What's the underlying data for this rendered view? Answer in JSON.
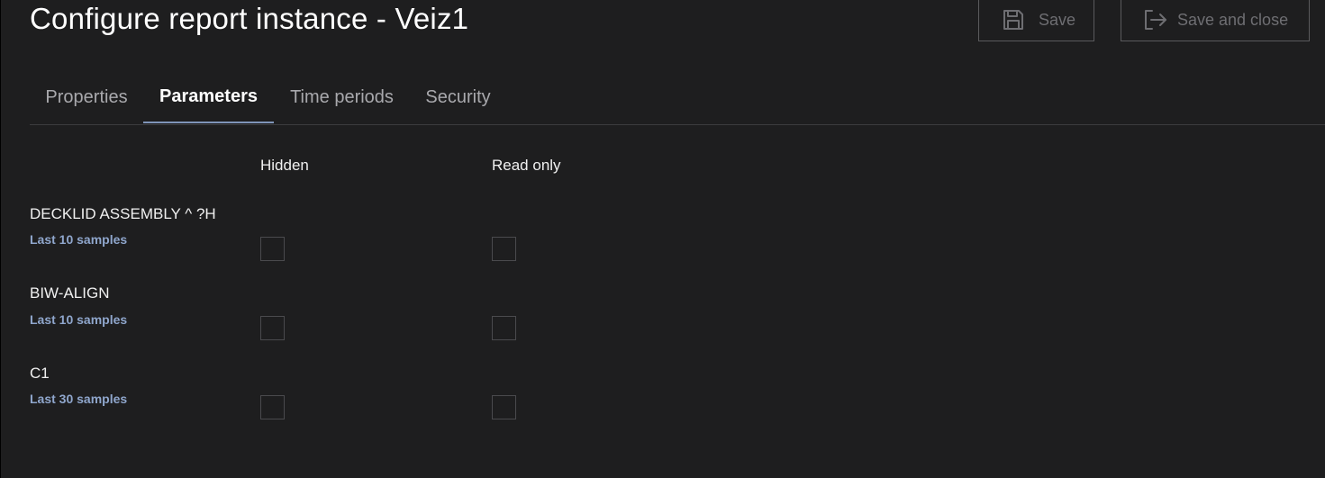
{
  "header": {
    "title": "Configure report instance - Veiz1",
    "save_label": "Save",
    "save_close_label": "Save and close",
    "save_icon": "floppy-disk-icon",
    "save_close_icon": "exit-icon"
  },
  "tabs": [
    {
      "label": "Properties",
      "active": false
    },
    {
      "label": "Parameters",
      "active": true
    },
    {
      "label": "Time periods",
      "active": false
    },
    {
      "label": "Security",
      "active": false
    }
  ],
  "columns": {
    "hidden": "Hidden",
    "read_only": "Read only"
  },
  "parameters": [
    {
      "name": "DECKLID ASSEMBLY ^ ?H",
      "period": "Last 10 samples",
      "hidden": false,
      "read_only": false
    },
    {
      "name": "BIW-ALIGN",
      "period": "Last 10 samples",
      "hidden": false,
      "read_only": false
    },
    {
      "name": "C1",
      "period": "Last 30 samples",
      "hidden": false,
      "read_only": false
    }
  ],
  "colors": {
    "background": "#1e1e1f",
    "accent": "#7f95b8",
    "link": "#8fa6cc",
    "disabled_text": "#6e6e72"
  }
}
